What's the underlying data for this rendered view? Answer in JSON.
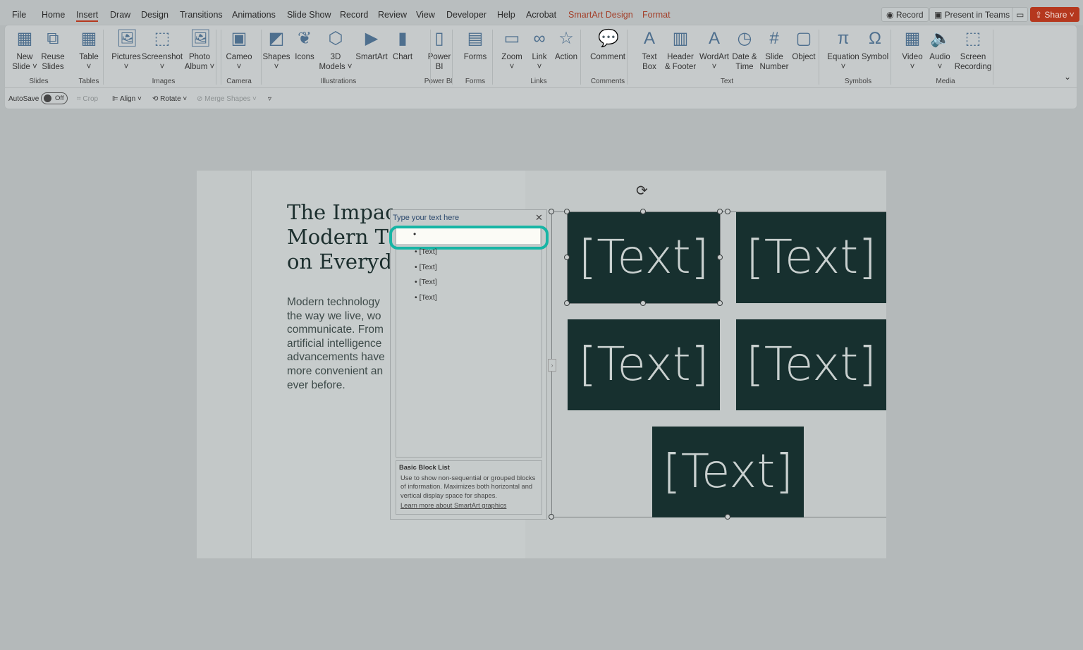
{
  "menu": [
    "File",
    "Home",
    "Insert",
    "Draw",
    "Design",
    "Transitions",
    "Animations",
    "Slide Show",
    "Record",
    "Review",
    "View",
    "Developer",
    "Help",
    "Acrobat",
    "SmartArt Design",
    "Format"
  ],
  "topbuttons": {
    "record": "Record",
    "present": "Present in Teams",
    "share": "Share"
  },
  "ribbon": {
    "buttons": [
      {
        "l1": "New",
        "l2": "Slide ˅",
        "icon": "new-slide-icon",
        "g": "▦"
      },
      {
        "l1": "Reuse",
        "l2": "Slides",
        "icon": "reuse-slides-icon",
        "g": "⧉"
      },
      {
        "l1": "Table",
        "l2": "˅",
        "icon": "table-icon",
        "g": "▦"
      },
      {
        "l1": "Pictures",
        "l2": "˅",
        "icon": "pictures-icon",
        "g": "🖼"
      },
      {
        "l1": "Screenshot",
        "l2": "˅",
        "icon": "screenshot-icon",
        "g": "⬚"
      },
      {
        "l1": "Photo",
        "l2": "Album ˅",
        "icon": "photo-album-icon",
        "g": "🖼"
      },
      {
        "l1": "Cameo",
        "l2": "˅",
        "icon": "cameo-icon",
        "g": "▣"
      },
      {
        "l1": "Shapes",
        "l2": "˅",
        "icon": "shapes-icon",
        "g": "◩"
      },
      {
        "l1": "Icons",
        "l2": "",
        "icon": "icons-icon",
        "g": "❦"
      },
      {
        "l1": "3D",
        "l2": "Models ˅",
        "icon": "3d-models-icon",
        "g": "⬡"
      },
      {
        "l1": "SmartArt",
        "l2": "",
        "icon": "smartart-icon",
        "g": "▶"
      },
      {
        "l1": "Chart",
        "l2": "",
        "icon": "chart-icon",
        "g": "▮"
      },
      {
        "l1": "Power",
        "l2": "BI",
        "icon": "power-bi-icon",
        "g": "▯"
      },
      {
        "l1": "Forms",
        "l2": "",
        "icon": "forms-icon",
        "g": "▤"
      },
      {
        "l1": "Zoom",
        "l2": "˅",
        "icon": "zoom-icon",
        "g": "▭"
      },
      {
        "l1": "Link",
        "l2": "˅",
        "icon": "link-icon",
        "g": "∞"
      },
      {
        "l1": "Action",
        "l2": "",
        "icon": "action-icon",
        "g": "☆"
      },
      {
        "l1": "Comment",
        "l2": "",
        "icon": "comment-icon",
        "g": "💬"
      },
      {
        "l1": "Text",
        "l2": "Box",
        "icon": "text-box-icon",
        "g": "A"
      },
      {
        "l1": "Header",
        "l2": "& Footer",
        "icon": "header-footer-icon",
        "g": "▥"
      },
      {
        "l1": "WordArt",
        "l2": "˅",
        "icon": "wordart-icon",
        "g": "A"
      },
      {
        "l1": "Date &",
        "l2": "Time",
        "icon": "date-time-icon",
        "g": "◷"
      },
      {
        "l1": "Slide",
        "l2": "Number",
        "icon": "slide-number-icon",
        "g": "#"
      },
      {
        "l1": "Object",
        "l2": "",
        "icon": "object-icon",
        "g": "▢"
      },
      {
        "l1": "Equation",
        "l2": "˅",
        "icon": "equation-icon",
        "g": "π"
      },
      {
        "l1": "Symbol",
        "l2": "",
        "icon": "symbol-icon",
        "g": "Ω"
      },
      {
        "l1": "Video",
        "l2": "˅",
        "icon": "video-icon",
        "g": "▦"
      },
      {
        "l1": "Audio",
        "l2": "˅",
        "icon": "audio-icon",
        "g": "🔈"
      },
      {
        "l1": "Screen",
        "l2": "Recording",
        "icon": "screen-recording-icon",
        "g": "⬚"
      }
    ],
    "groups": [
      "Slides",
      "Tables",
      "Images",
      "Camera",
      "Illustrations",
      "Power BI",
      "Forms",
      "Links",
      "Comments",
      "Text",
      "Symbols",
      "Media"
    ]
  },
  "qat": {
    "autosave": "AutoSave",
    "off": "Off",
    "crop": "Crop",
    "align": "Align ˅",
    "rotate": "Rotate ˅",
    "merge": "Merge Shapes ˅"
  },
  "slide": {
    "title": "The Impact of Modern Technology on Everyday",
    "title_lines": [
      "The Impact of",
      "Modern T",
      "on Everyd"
    ],
    "body_lines": [
      "Modern technology",
      "the way we live, wo",
      "communicate. From",
      "artificial intelligence",
      "advancements have",
      "more convenient an",
      "ever before."
    ],
    "blocks": [
      "[Text]",
      "[Text]",
      "[Text]",
      "[Text]",
      "[Text]"
    ]
  },
  "textpane": {
    "title": "Type your text here",
    "items": [
      "[Text]",
      "[Text]",
      "[Text]",
      "[Text]"
    ],
    "info_title": "Basic Block List",
    "info_text": "Use to show non-sequential or grouped blocks of information. Maximizes both horizontal and vertical display space for shapes.",
    "learn_more": "Learn more about SmartArt graphics"
  },
  "colors": {
    "block": "#17302f",
    "accent": "#b5381e",
    "focus": "#17b5a5"
  }
}
